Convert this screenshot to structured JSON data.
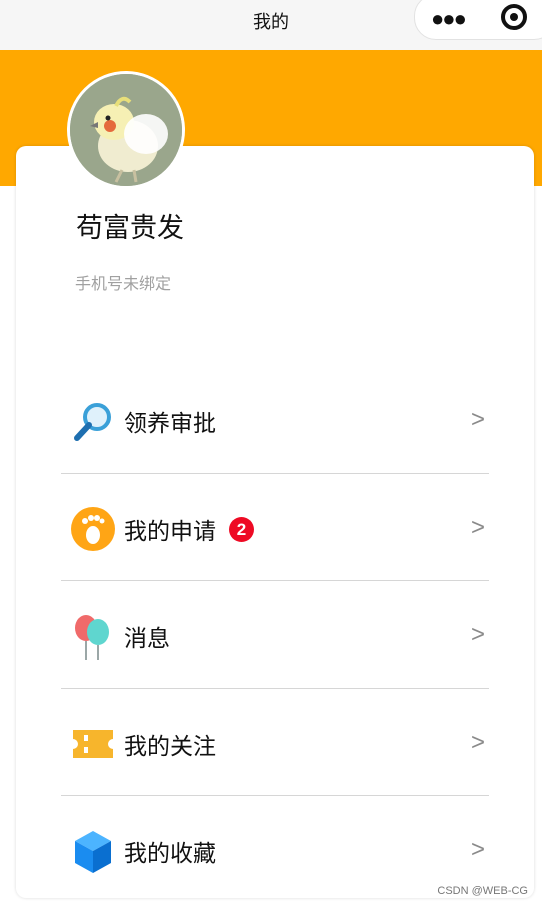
{
  "nav": {
    "title": "我的"
  },
  "profile": {
    "name": "苟富贵发",
    "phone": "手机号未绑定"
  },
  "menu": [
    {
      "label": "领养审批",
      "icon": "magnifier-icon",
      "arrow": ">"
    },
    {
      "label": "我的申请",
      "icon": "footprint-icon",
      "badge": "2",
      "arrow": ">"
    },
    {
      "label": "消息",
      "icon": "balloons-icon",
      "arrow": ">"
    },
    {
      "label": "我的关注",
      "icon": "ticket-icon",
      "arrow": ">"
    },
    {
      "label": "我的收藏",
      "icon": "cube-icon",
      "arrow": ">"
    }
  ],
  "watermark": "CSDN @WEB-CG",
  "colors": {
    "banner": "#ffa800",
    "badge": "#ee0a24"
  }
}
